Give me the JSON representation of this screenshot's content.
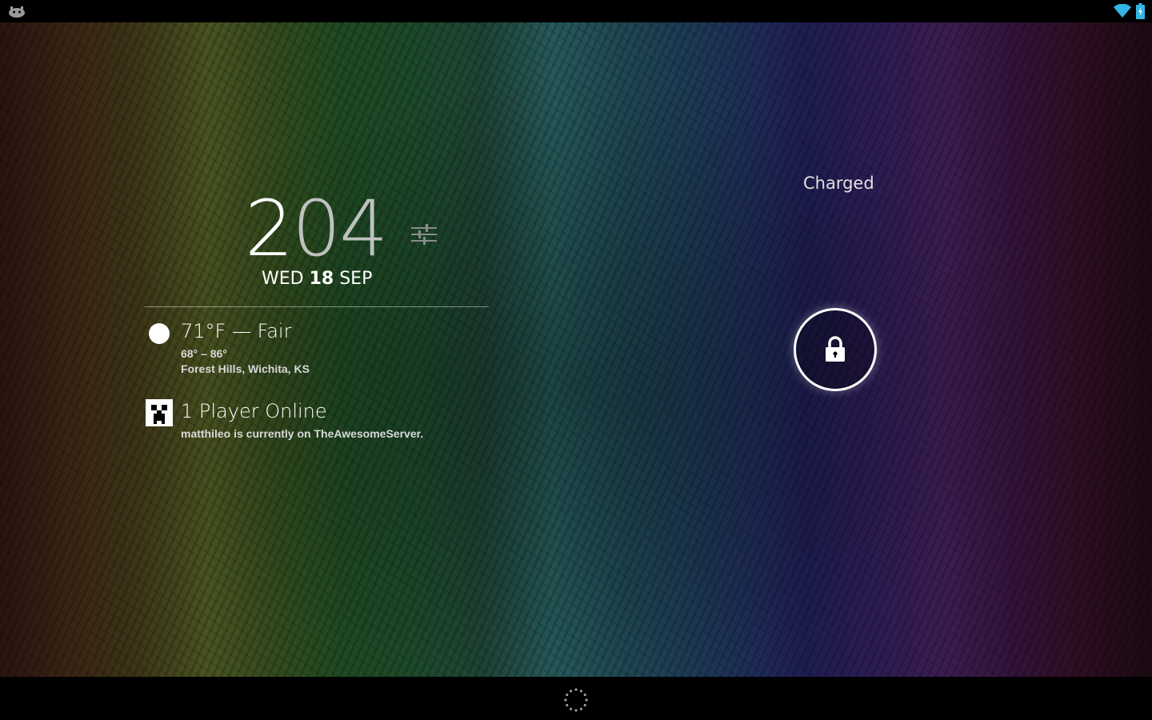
{
  "status_bar": {
    "left_icon": "android-notification-icon",
    "wifi_icon": "wifi-icon",
    "battery_icon": "battery-charging-icon"
  },
  "clock": {
    "hours": "2",
    "minutes": "04",
    "settings_icon": "sliders-icon"
  },
  "date": {
    "weekday": "WED",
    "day": "18",
    "month": "SEP"
  },
  "weather": {
    "icon": "sun-icon",
    "summary": "71°F — Fair",
    "range": "68° – 86°",
    "location": "Forest Hills, Wichita, KS"
  },
  "player_widget": {
    "icon": "creeper-icon",
    "title": "1 Player Online",
    "subtitle": "matthileo is currently on TheAwesomeServer."
  },
  "lockscreen": {
    "charge_status": "Charged",
    "unlock_icon": "lock-icon"
  },
  "nav_bar": {
    "icon": "loading-spinner-icon"
  },
  "colors": {
    "text_primary": "#ffffff",
    "text_secondary": "#d8d8d8",
    "wifi_accent": "#33b5e5"
  }
}
